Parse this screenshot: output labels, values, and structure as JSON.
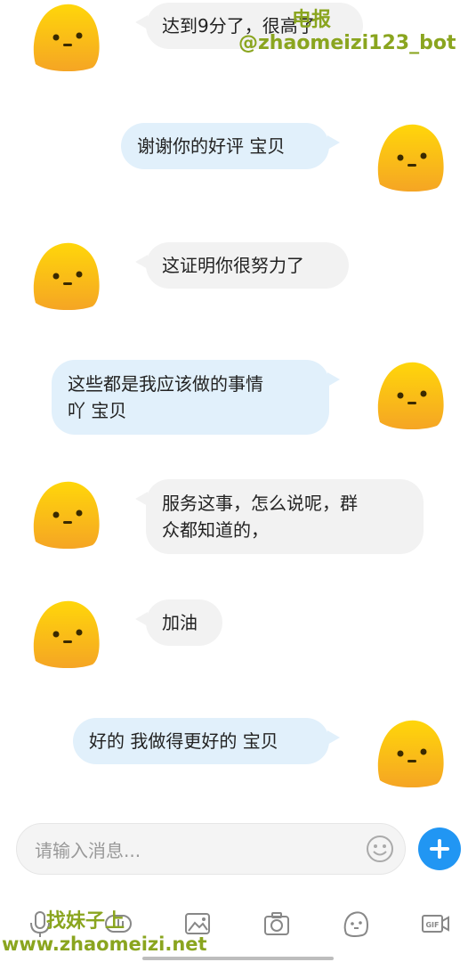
{
  "messages": [
    {
      "side": "in",
      "text": "达到9分了，很高了"
    },
    {
      "side": "out",
      "text": "谢谢你的好评 宝贝"
    },
    {
      "side": "in",
      "text": "这证明你很努力了"
    },
    {
      "side": "out",
      "text": "这些都是我应该做的事情\n吖 宝贝"
    },
    {
      "side": "in",
      "text": "服务这事，怎么说呢，群\n众都知道的，"
    },
    {
      "side": "in",
      "text": "加油"
    },
    {
      "side": "out",
      "text": "好的 我做得更好的 宝贝"
    }
  ],
  "watermarks": {
    "top_line1": "电报",
    "top_line2": "@zhaomeizi123_bot",
    "bottom_line1": "找妹子上",
    "bottom_line2": "www.zhaomeizi.net"
  },
  "input": {
    "placeholder": "请输入消息..."
  },
  "toolbar": {
    "icons": [
      "microphone-icon",
      "voice-icon",
      "image-icon",
      "camera-icon",
      "emoji-icon",
      "gif-icon"
    ]
  },
  "colors": {
    "avatar_top": "#ffd400",
    "avatar_bottom": "#f5a623",
    "send_button": "#2196f3",
    "watermark": "#8aa51f"
  }
}
